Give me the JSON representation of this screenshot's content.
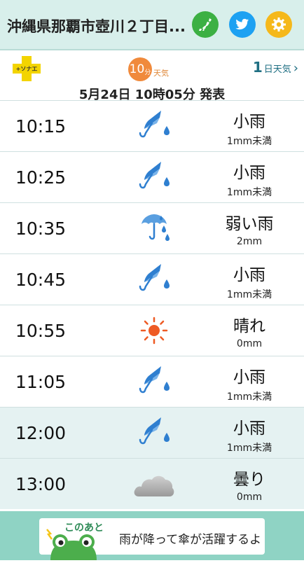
{
  "header": {
    "title": "沖縄県那覇市壺川２丁目...",
    "icons": [
      "japan-map-icon",
      "twitter-icon",
      "gear-icon"
    ]
  },
  "subbar": {
    "sonae_label": "+ソナエ",
    "ten_min_number": "10",
    "ten_min_unit": "分",
    "ten_min_word": "天気",
    "one_day_number": "1",
    "one_day_label": "日天気",
    "one_day_arrow": "›",
    "issued": "5月24日 10時05分 発表"
  },
  "forecast": [
    {
      "time": "10:15",
      "weather": "小雨",
      "rain": "1mm未満",
      "icon": "light-rain-icon"
    },
    {
      "time": "10:25",
      "weather": "小雨",
      "rain": "1mm未満",
      "icon": "light-rain-icon"
    },
    {
      "time": "10:35",
      "weather": "弱い雨",
      "rain": "2mm",
      "icon": "weak-rain-icon"
    },
    {
      "time": "10:45",
      "weather": "小雨",
      "rain": "1mm未満",
      "icon": "light-rain-icon"
    },
    {
      "time": "10:55",
      "weather": "晴れ",
      "rain": "0mm",
      "icon": "sun-icon"
    },
    {
      "time": "11:05",
      "weather": "小雨",
      "rain": "1mm未満",
      "icon": "light-rain-icon"
    },
    {
      "time": "12:00",
      "weather": "小雨",
      "rain": "1mm未満",
      "icon": "light-rain-icon"
    },
    {
      "time": "13:00",
      "weather": "曇り",
      "rain": "0mm",
      "icon": "cloud-icon"
    }
  ],
  "footer": {
    "badge": "このあと",
    "message": "雨が降って傘が活躍するよ"
  },
  "colors": {
    "header_bg": "#d8efeb",
    "accent_teal": "#1f6f83",
    "ten_min_orange": "#f08a3c",
    "row_shaded": "#e5f2f2",
    "footer_bg": "#8fd3c4"
  }
}
